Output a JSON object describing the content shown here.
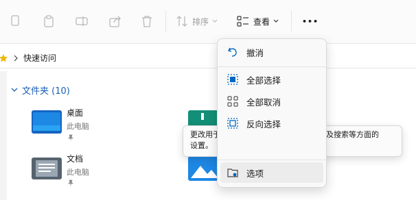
{
  "toolbar": {
    "sort_label": "排序",
    "view_label": "查看",
    "more_label": "•••"
  },
  "address": {
    "path": "快速访问"
  },
  "group": {
    "title": "文件夹 (10)"
  },
  "items": [
    {
      "name": "桌面",
      "location": "此电脑"
    },
    {
      "name": "文档",
      "location": "此电脑"
    }
  ],
  "menu": {
    "items": [
      {
        "label": "撤消"
      },
      {
        "label": "全部选择"
      },
      {
        "label": "全部取消"
      },
      {
        "label": "反向选择"
      },
      {
        "label": "选项"
      }
    ]
  },
  "tooltip": {
    "line1": "更改用于打开项目、文件和文件夹视图以及搜索等方面的",
    "line2": "设置。"
  },
  "colors": {
    "accent": "#0067c0",
    "folder_blue": "#1e88e5",
    "folder_teal": "#14a085",
    "folder_gray": "#6e7c89"
  }
}
